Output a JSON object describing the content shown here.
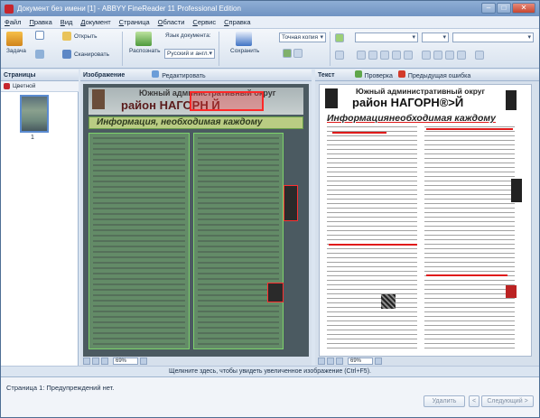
{
  "window": {
    "title": "Документ без имени [1] - ABBYY FineReader 11 Professional Edition"
  },
  "menu": [
    "Файл",
    "Правка",
    "Вид",
    "Документ",
    "Страница",
    "Области",
    "Сервис",
    "Справка"
  ],
  "toolbar": {
    "task_label": "Задача",
    "open_label": "Открыть",
    "scan_label": "Сканировать",
    "recognize_label": "Распознать",
    "doc_language_label": "Язык документа:",
    "doc_language_value": "Русский и англ.",
    "save_label": "Сохранить",
    "copy_mode_value": "Точная копия"
  },
  "pages_pane": {
    "title": "Страницы",
    "view_mode": "Цветной",
    "page_number": "1"
  },
  "image_pane": {
    "title": "Изображение",
    "edit_label": "Редактировать",
    "zoom": "69%",
    "scan_header_line1": "Южный административный округ",
    "scan_header_line2": "район НАГОРН  Й",
    "scan_band": "Информация, необходимая каждому"
  },
  "text_pane": {
    "title": "Текст",
    "check_label": "Проверка",
    "prev_error_label": "Предыдущая ошибка",
    "zoom": "69%",
    "doc_line1": "Южный административный округ",
    "doc_line2": "район НАГОРН®>Й",
    "doc_line3": "Информациянеобходимая каждому"
  },
  "zoom_hint": "Щелкните здесь, чтобы увидеть увеличенное изображение (Ctrl+F5).",
  "warnings": {
    "message": "Страница 1: Предупреждений нет.",
    "delete_label": "Удалить",
    "next_label": "Следующий >"
  }
}
